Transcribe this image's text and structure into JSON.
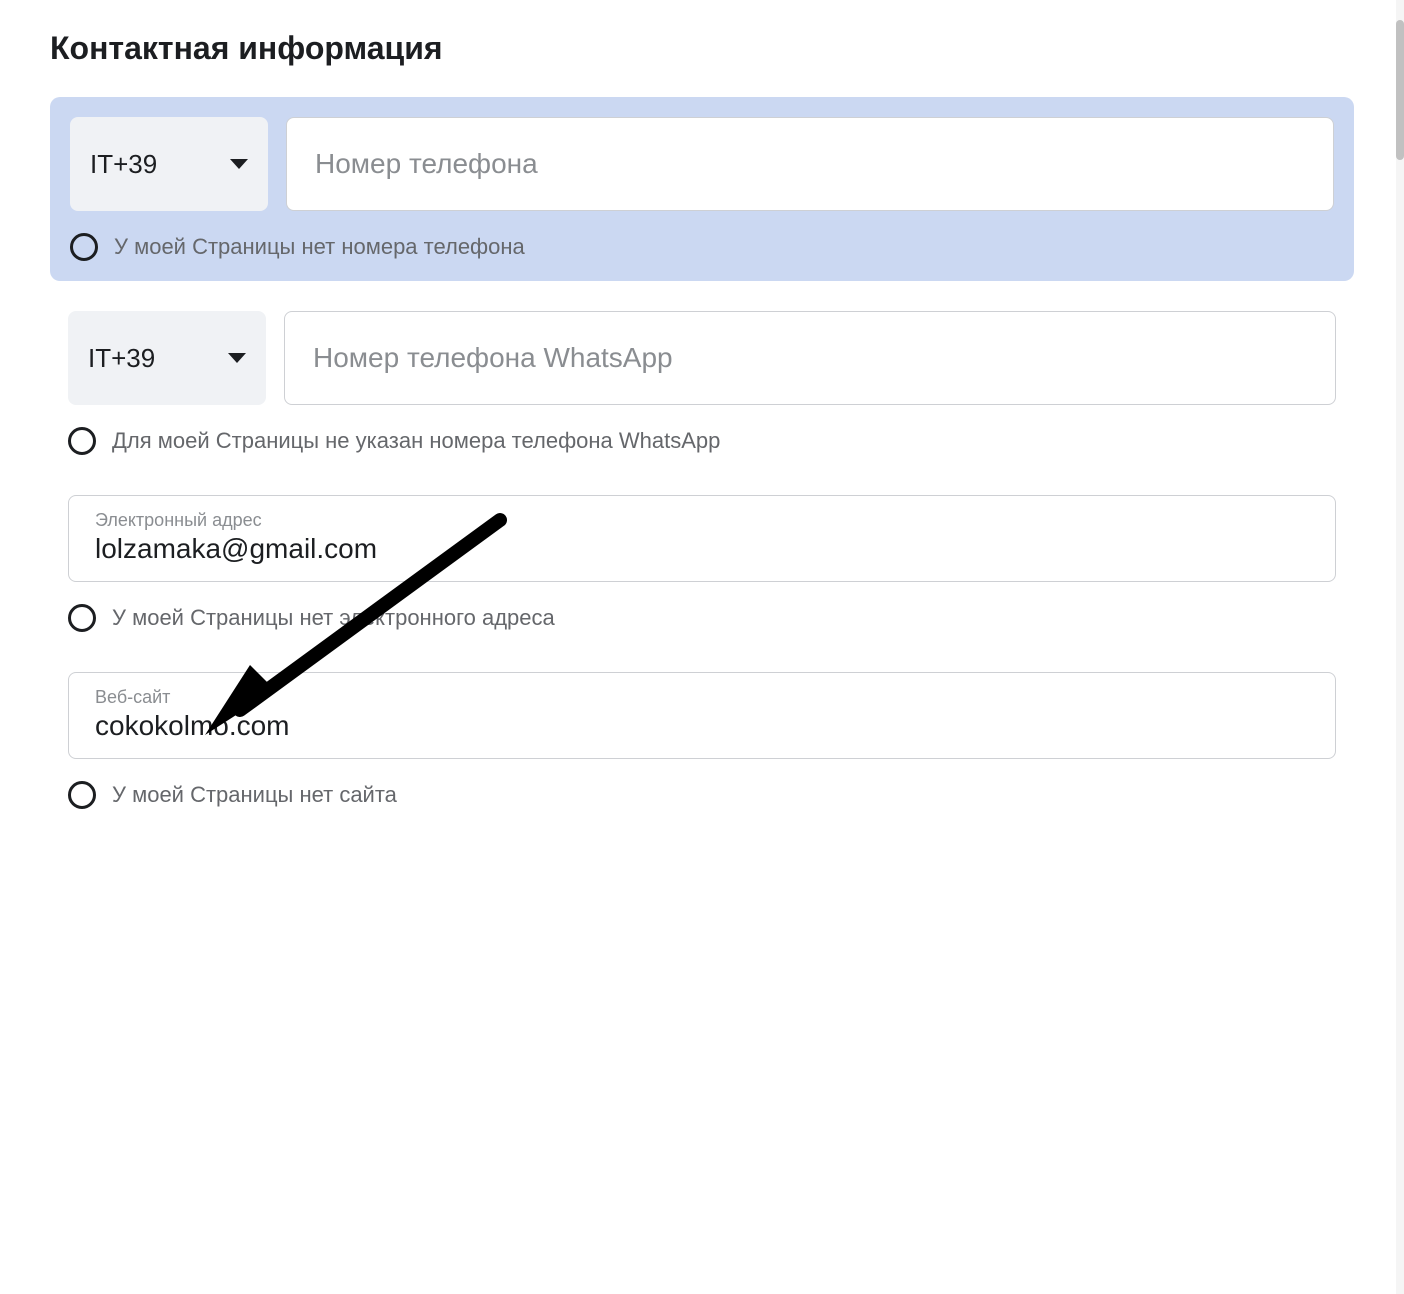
{
  "heading": "Контактная информация",
  "phone": {
    "country_code": "IT+39",
    "placeholder": "Номер телефона",
    "no_phone_label": "У моей Страницы нет номера телефона"
  },
  "whatsapp": {
    "country_code": "IT+39",
    "placeholder": "Номер телефона WhatsApp",
    "no_whatsapp_label": "Для моей Страницы не указан номера телефона WhatsApp"
  },
  "email": {
    "label": "Электронный адрес",
    "value": "lolzamaka@gmail.com",
    "no_email_label": "У моей Страницы нет электронного адреса"
  },
  "website": {
    "label": "Веб-сайт",
    "value": "cokokolmo.com",
    "no_website_label": "У моей Страницы нет сайта"
  }
}
